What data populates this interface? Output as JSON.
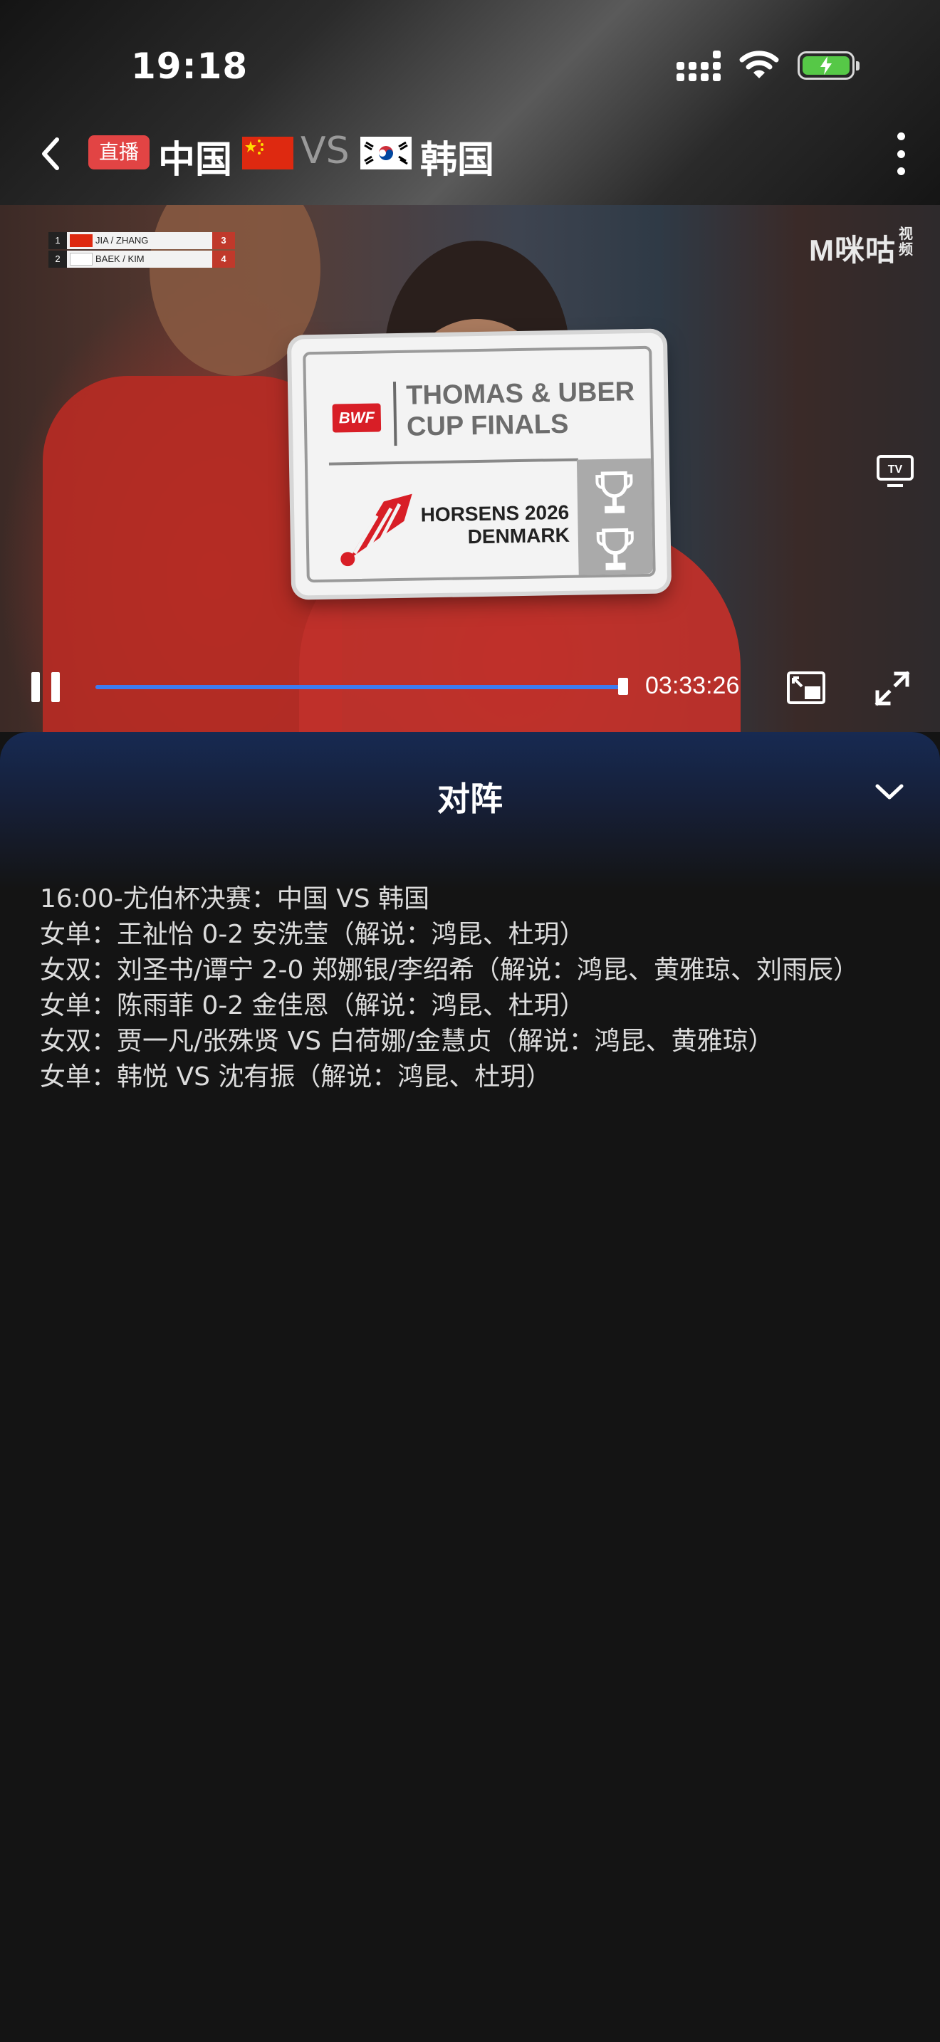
{
  "status_bar": {
    "time": "19:18",
    "icons": [
      "signal-icon",
      "wifi-icon",
      "battery-charging-icon"
    ]
  },
  "header": {
    "live_badge": "直播",
    "team_a": "中国",
    "vs": "VS",
    "team_b": "韩国",
    "back_icon": "chevron-left-icon",
    "more_icon": "more-vertical-icon"
  },
  "video": {
    "scoreboard": [
      {
        "rank": "1",
        "name": "JIA / ZHANG",
        "score": "3"
      },
      {
        "rank": "2",
        "name": "BAEK / KIM",
        "score": "4"
      }
    ],
    "brand": "M咪咕",
    "brand_sub": "视频",
    "cup_card": {
      "org": "BWF",
      "title_line1": "THOMAS & UBER",
      "title_line2": "CUP FINALS",
      "city_line1": "HORSENS 2026",
      "city_line2": "DENMARK"
    },
    "elapsed_time": "03:33:26",
    "progress_fraction": 0.99
  },
  "sheet": {
    "title": "对阵",
    "schedule": [
      "16:00-尤伯杯决赛：中国 VS 韩国",
      "女单：王祉怡 0-2 安洗莹（解说：鸿昆、杜玥）",
      "女双：刘圣书/谭宁 2-0 郑娜银/李绍希（解说：鸿昆、黄雅琼、刘雨辰）",
      "女单：陈雨菲 0-2 金佳恩（解说：鸿昆、杜玥）",
      "女双：贾一凡/张殊贤 VS 白荷娜/金慧贞（解说：鸿昆、黄雅琼）",
      "女单：韩悦 VS 沈有振（解说：鸿昆、杜玥）"
    ]
  },
  "colors": {
    "live_badge": "#e24444",
    "progress": "#3d7bf0",
    "background": "#141414",
    "sheet_glow": "#172a52"
  }
}
